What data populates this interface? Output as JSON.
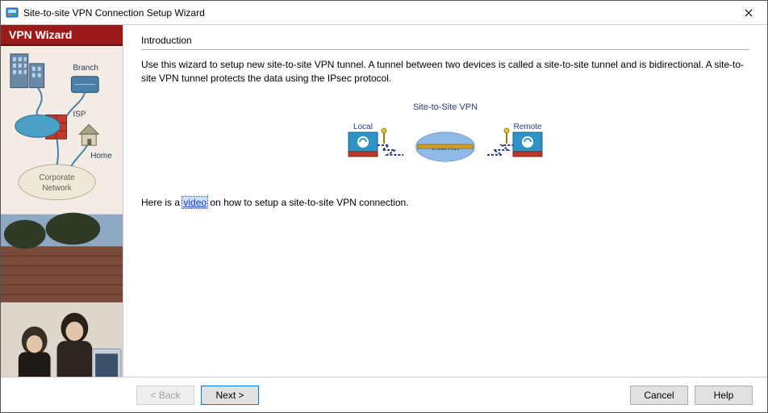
{
  "titlebar": {
    "title": "Site-to-site VPN Connection Setup Wizard"
  },
  "sidebar": {
    "title": "VPN Wizard",
    "labels": {
      "branch": "Branch",
      "isp": "ISP",
      "home": "Home",
      "corp_line1": "Corporate",
      "corp_line2": "Network"
    }
  },
  "main": {
    "heading": "Introduction",
    "paragraph": "Use this wizard to setup new site-to-site VPN tunnel. A tunnel between two devices is called a site-to-site tunnel and is bidirectional. A site-to-site VPN tunnel protects the data using the IPsec protocol.",
    "diagram": {
      "title": "Site-to-Site VPN",
      "local": "Local",
      "remote": "Remote",
      "internet": "Internet"
    },
    "video_prefix": "Here is a ",
    "video_link": "video",
    "video_suffix": " on how to setup a site-to-site VPN connection."
  },
  "footer": {
    "back": "< Back",
    "next": "Next >",
    "cancel": "Cancel",
    "help": "Help"
  }
}
